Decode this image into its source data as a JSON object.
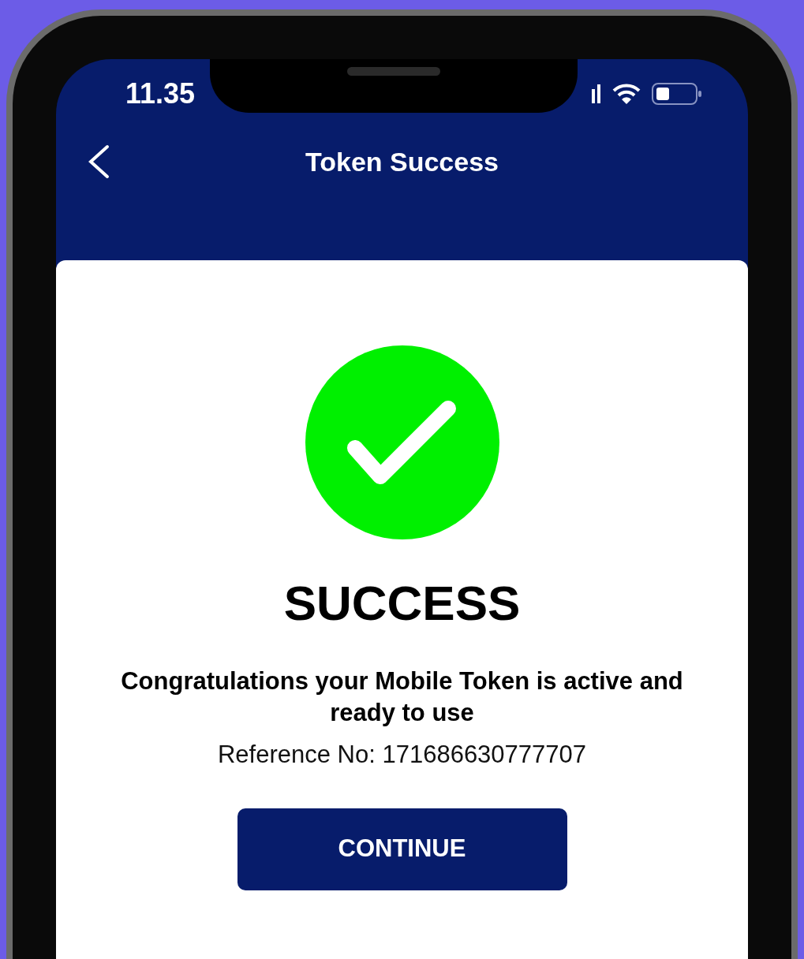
{
  "status_bar": {
    "time": "11.35"
  },
  "header": {
    "title": "Token Success"
  },
  "result": {
    "title": "SUCCESS",
    "message": "Congratulations your Mobile Token is active and ready to use",
    "reference": "Reference No: 171686630777707"
  },
  "buttons": [
    {
      "label": "CONTINUE"
    }
  ]
}
